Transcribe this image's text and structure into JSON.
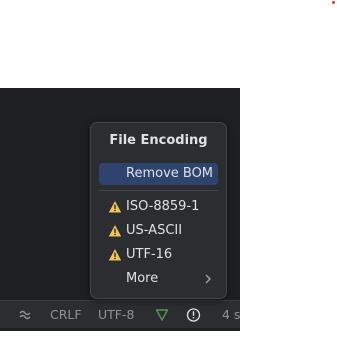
{
  "popup": {
    "title": "File Encoding",
    "items": [
      {
        "label": "Remove BOM",
        "selected": true
      },
      {
        "label": "ISO-8859-1",
        "icon": "warning-icon"
      },
      {
        "label": "US-ASCII",
        "icon": "warning-icon"
      },
      {
        "label": "UTF-16",
        "icon": "warning-icon"
      },
      {
        "label": "More",
        "icon": "chevron-right-icon"
      }
    ]
  },
  "statusbar": {
    "line_separator": "CRLF",
    "encoding": "UTF-8",
    "indent_hint": "4 s"
  },
  "colors": {
    "editor_bg": "#1e1f22",
    "popup_bg": "#2b2d30",
    "selection": "#2e436e",
    "warning": "#f2c55c",
    "vcs_green": "#57965c"
  }
}
